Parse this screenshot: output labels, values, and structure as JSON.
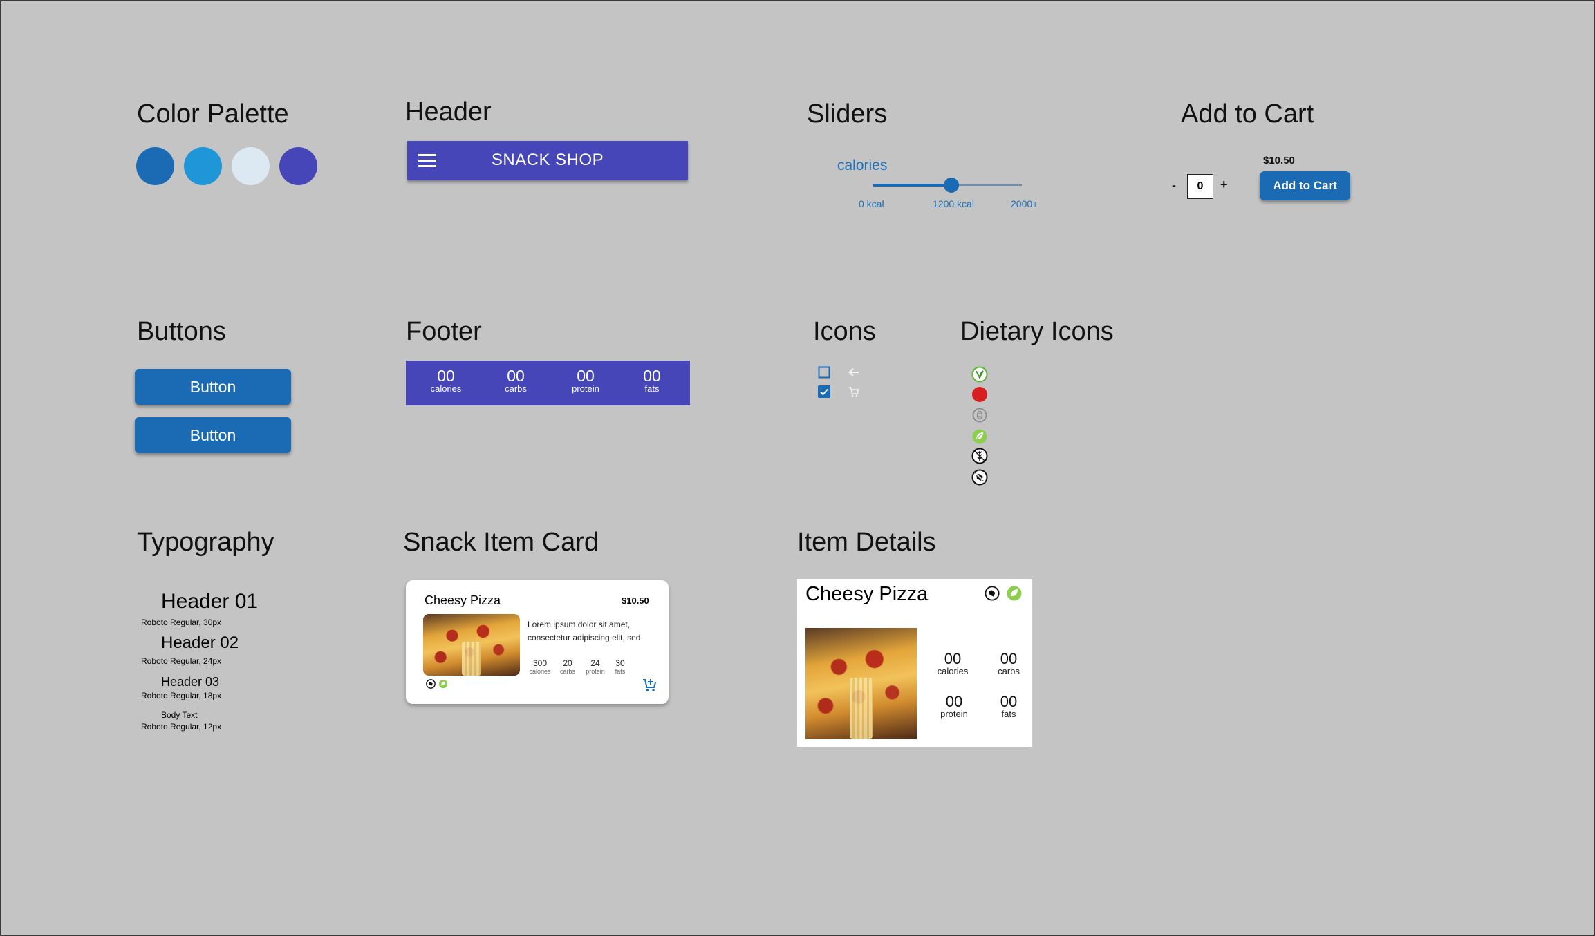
{
  "sections": {
    "color_palette": "Color Palette",
    "header": "Header",
    "sliders": "Sliders",
    "add_to_cart": "Add to Cart",
    "buttons": "Buttons",
    "footer": "Footer",
    "icons": "Icons",
    "dietary_icons": "Dietary Icons",
    "typography": "Typography",
    "snack_item_card": "Snack Item Card",
    "item_details": "Item Details"
  },
  "palette": [
    "#1a6bb4",
    "#1f96d8",
    "#dce9f2",
    "#4646b8"
  ],
  "header": {
    "title": "SNACK SHOP",
    "menu_icon": "hamburger-menu-icon"
  },
  "slider": {
    "label": "calories",
    "value_fraction": 0.53,
    "ticks": [
      "0 kcal",
      "1200 kcal",
      "2000+"
    ]
  },
  "add_to_cart": {
    "decrement": "-",
    "quantity": "0",
    "increment": "+",
    "price": "$10.50",
    "button": "Add to Cart"
  },
  "buttons": [
    "Button",
    "Button"
  ],
  "footer": {
    "stats": [
      {
        "value": "00",
        "label": "calories"
      },
      {
        "value": "00",
        "label": "carbs"
      },
      {
        "value": "00",
        "label": "protein"
      },
      {
        "value": "00",
        "label": "fats"
      }
    ]
  },
  "icons": [
    "checkbox-empty-icon",
    "checkbox-checked-icon",
    "back-arrow-icon",
    "cart-icon"
  ],
  "dietary_icons": [
    "vegan-icon",
    "red-dot-icon",
    "nut-free-icon",
    "vegetarian-leaf-icon",
    "gluten-free-icon",
    "dairy-free-icon"
  ],
  "typography": {
    "h1": "Header 01",
    "h1_spec": "Roboto Regular, 30px",
    "h2": "Header 02",
    "h2_spec": "Roboto Regular, 24px",
    "h3": "Header 03",
    "h3_spec": "Roboto Regular, 18px",
    "body": "Body Text",
    "body_spec": "Roboto Regular, 12px"
  },
  "snack_card": {
    "name": "Cheesy Pizza",
    "price": "$10.50",
    "description_line1": "Lorem ipsum dolor sit amet,",
    "description_line2": "consectetur adipiscing elit, sed",
    "stats": [
      {
        "value": "300",
        "label": "calories"
      },
      {
        "value": "20",
        "label": "carbs"
      },
      {
        "value": "24",
        "label": "protein"
      },
      {
        "value": "30",
        "label": "fats"
      }
    ]
  },
  "item_details": {
    "name": "Cheesy Pizza",
    "stats": [
      {
        "value": "00",
        "label": "calories"
      },
      {
        "value": "00",
        "label": "carbs"
      },
      {
        "value": "00",
        "label": "protein"
      },
      {
        "value": "00",
        "label": "fats"
      }
    ]
  }
}
